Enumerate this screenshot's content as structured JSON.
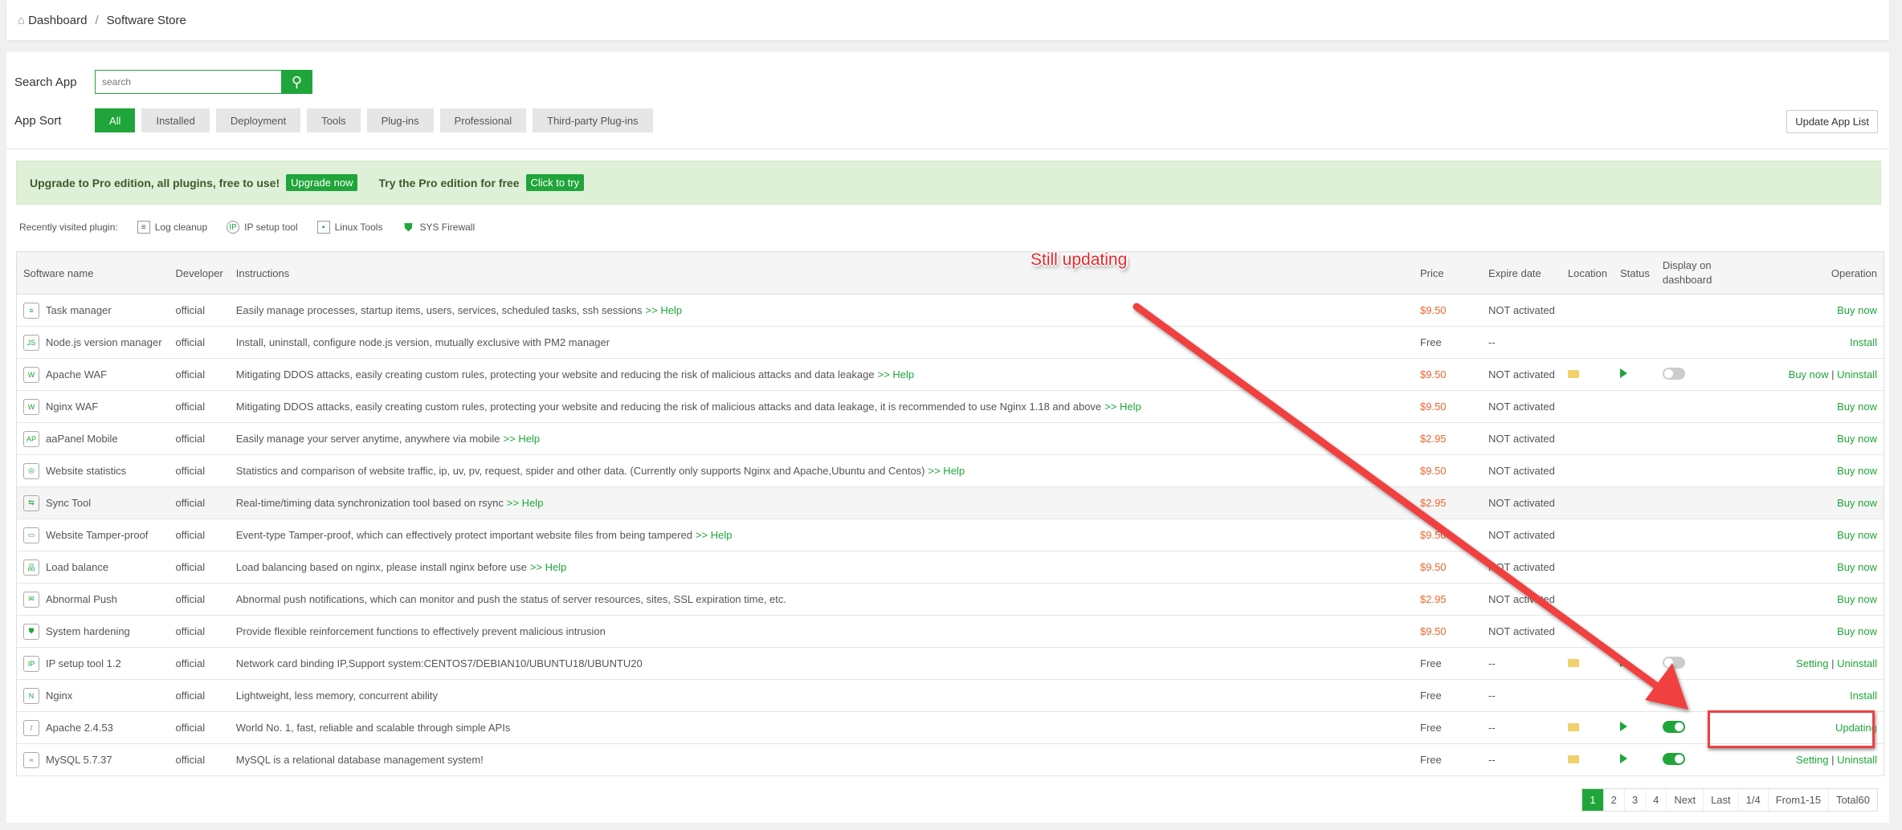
{
  "breadcrumb": {
    "home": "Dashboard",
    "current": "Software Store"
  },
  "search": {
    "label": "Search App",
    "placeholder": "search"
  },
  "sort": {
    "label": "App Sort",
    "items": [
      "All",
      "Installed",
      "Deployment",
      "Tools",
      "Plug-ins",
      "Professional",
      "Third-party Plug-ins"
    ],
    "active": "All"
  },
  "update_list": "Update App List",
  "banner": {
    "text1": "Upgrade to Pro edition, all plugins, free to use!",
    "btn1": "Upgrade now",
    "text2": "Try the Pro edition for free",
    "btn2": "Click to try"
  },
  "recent": {
    "label": "Recently visited plugin:",
    "items": [
      "Log cleanup",
      "IP setup tool",
      "Linux Tools",
      "SYS Firewall"
    ]
  },
  "table": {
    "headers": [
      "Software name",
      "Developer",
      "Instructions",
      "Price",
      "Expire date",
      "Location",
      "Status",
      "Display on dashboard",
      "Operation"
    ],
    "rows": [
      {
        "name": "Task manager",
        "dev": "official",
        "desc": "Easily manage processes, startup items, users, services, scheduled tasks, ssh sessions",
        "help": ">> Help",
        "price": "$9.50",
        "expire": "NOT activated",
        "op": [
          "Buy now"
        ]
      },
      {
        "name": "Node.js version manager",
        "dev": "official",
        "desc": "Install, uninstall, configure node.js version, mutually exclusive with PM2 manager",
        "help": "",
        "price": "Free",
        "expire": "--",
        "op": [
          "Install"
        ]
      },
      {
        "name": "Apache WAF",
        "dev": "official",
        "desc": "Mitigating DDOS attacks, easily creating custom rules, protecting your website and reducing the risk of malicious attacks and data leakage",
        "help": ">> Help",
        "price": "$9.50",
        "expire": "NOT activated",
        "installed": true,
        "dash": false,
        "op": [
          "Buy now",
          "Uninstall"
        ]
      },
      {
        "name": "Nginx WAF",
        "dev": "official",
        "desc": "Mitigating DDOS attacks, easily creating custom rules, protecting your website and reducing the risk of malicious attacks and data leakage, it is recommended to use Nginx 1.18 and above",
        "help": ">> Help",
        "price": "$9.50",
        "expire": "NOT activated",
        "op": [
          "Buy now"
        ]
      },
      {
        "name": "aaPanel Mobile",
        "dev": "official",
        "desc": "Easily manage your server anytime, anywhere via mobile",
        "help": ">> Help",
        "price": "$2.95",
        "expire": "NOT activated",
        "op": [
          "Buy now"
        ]
      },
      {
        "name": "Website statistics",
        "dev": "official",
        "desc": "Statistics and comparison of website traffic, ip, uv, pv, request, spider and other data. (Currently only supports Nginx and Apache,Ubuntu and Centos)",
        "help": ">> Help",
        "price": "$9.50",
        "expire": "NOT activated",
        "op": [
          "Buy now"
        ]
      },
      {
        "name": "Sync Tool",
        "dev": "official",
        "desc": "Real-time/timing data synchronization tool based on rsync",
        "help": ">> Help",
        "price": "$2.95",
        "expire": "NOT activated",
        "op": [
          "Buy now"
        ]
      },
      {
        "name": "Website Tamper-proof",
        "dev": "official",
        "desc": "Event-type Tamper-proof, which can effectively protect important website files from being tampered",
        "help": ">> Help",
        "price": "$9.50",
        "expire": "NOT activated",
        "op": [
          "Buy now"
        ]
      },
      {
        "name": "Load balance",
        "dev": "official",
        "desc": "Load balancing based on nginx, please install nginx before use",
        "help": ">> Help",
        "price": "$9.50",
        "expire": "NOT activated",
        "op": [
          "Buy now"
        ]
      },
      {
        "name": "Abnormal Push",
        "dev": "official",
        "desc": "Abnormal push notifications, which can monitor and push the status of server resources, sites, SSL expiration time, etc.",
        "help": "",
        "price": "$2.95",
        "expire": "NOT activated",
        "op": [
          "Buy now"
        ]
      },
      {
        "name": "System hardening",
        "dev": "official",
        "desc": "Provide flexible reinforcement functions to effectively prevent malicious intrusion",
        "help": "",
        "price": "$9.50",
        "expire": "NOT activated",
        "op": [
          "Buy now"
        ]
      },
      {
        "name": "IP setup tool 1.2",
        "dev": "official",
        "desc": "Network card binding IP,Support system:CENTOS7/DEBIAN10/UBUNTU18/UBUNTU20",
        "help": "",
        "price": "Free",
        "expire": "--",
        "installed": true,
        "dash": false,
        "op": [
          "Setting",
          "Uninstall"
        ]
      },
      {
        "name": "Nginx",
        "dev": "official",
        "desc": "Lightweight, less memory, concurrent ability",
        "help": "",
        "price": "Free",
        "expire": "--",
        "op": [
          "Install"
        ]
      },
      {
        "name": "Apache 2.4.53",
        "dev": "official",
        "desc": "World No. 1, fast, reliable and scalable through simple APIs",
        "help": "",
        "price": "Free",
        "expire": "--",
        "installed": true,
        "dash": true,
        "op": [
          "Updating"
        ]
      },
      {
        "name": "MySQL 5.7.37",
        "dev": "official",
        "desc": "MySQL is a relational database management system!",
        "help": "",
        "price": "Free",
        "expire": "--",
        "installed": true,
        "dash": true,
        "op": [
          "Setting",
          "Uninstall"
        ]
      }
    ]
  },
  "pager": {
    "pages": [
      "1",
      "2",
      "3",
      "4"
    ],
    "current": "1",
    "next": "Next",
    "last": "Last",
    "ratio": "1/4",
    "range": "From1-15",
    "total": "Total60"
  },
  "annotation": {
    "text": "Still updating"
  },
  "colors": {
    "accent": "#20a53a",
    "price": "#f0652f",
    "annotation": "#e8262b"
  }
}
